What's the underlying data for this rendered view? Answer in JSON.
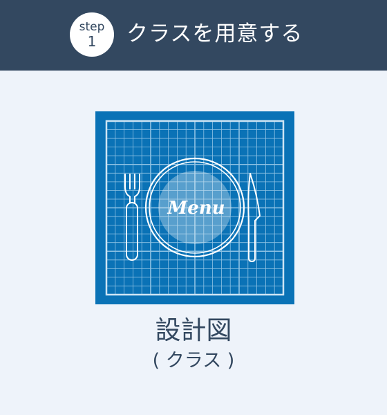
{
  "header": {
    "step_word": "step",
    "step_number": "1",
    "title": "クラスを用意する"
  },
  "illustration": {
    "icon": "blueprint-menu-icon",
    "plate_text": "Menu",
    "colors": {
      "blueprint": "#0a72b6",
      "grid": "#8fc3e4",
      "line": "#ffffff"
    }
  },
  "caption": {
    "main": "設計図",
    "sub": "( クラス )"
  },
  "colors": {
    "header_bg": "#334860",
    "page_bg": "#eef3fa",
    "text": "#334860"
  }
}
